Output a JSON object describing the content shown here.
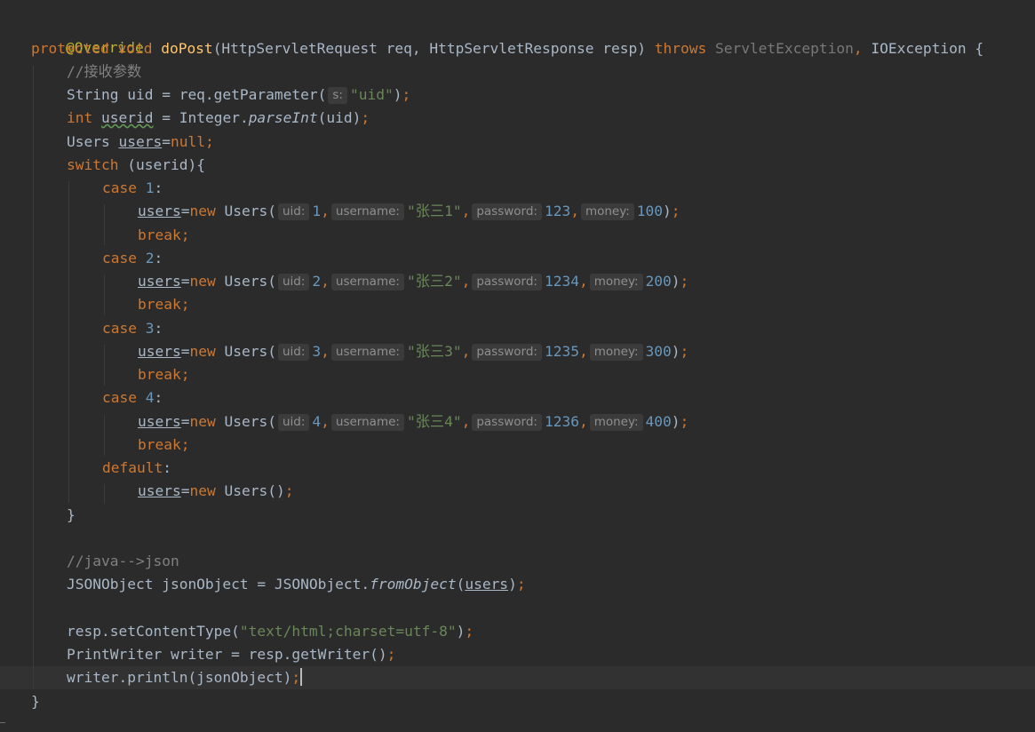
{
  "code": {
    "annotation": "@Override",
    "signature": {
      "modifier": "protected",
      "return_type": "void",
      "method_name": "doPost",
      "params": "(HttpServletRequest req, HttpServletResponse resp) ",
      "throws_kw": "throws",
      "exception1": "ServletException",
      "sep": ", ",
      "exception2": "IOException {"
    },
    "comment_params": "//接收参数",
    "line_uid": {
      "before": "String uid = req.getParameter(",
      "hint": "s:",
      "string": "\"uid\"",
      "close": ")",
      "semi": ";"
    },
    "line_userid": {
      "type": "int",
      "var": "userid",
      "rest": " = Integer.",
      "method": "parseInt",
      "args": "(uid)",
      "semi": ";"
    },
    "line_users_null": {
      "type": "Users ",
      "var": "users",
      "eq": "=",
      "null": "null",
      "semi": ";"
    },
    "line_switch": {
      "kw": "switch",
      "rest": " (userid){"
    },
    "cases": [
      {
        "case_kw": "case",
        "num": "1",
        "colon": ":",
        "var": "users",
        "eq": "=",
        "new": "new",
        "ctor": " Users(",
        "hint_uid": "uid:",
        "uid": "1",
        "hint_username": "username:",
        "username": "\"张三1\"",
        "hint_password": "password:",
        "password": "123",
        "hint_money": "money:",
        "money": "100",
        "close": ")",
        "semi": ";",
        "break": "break;"
      },
      {
        "case_kw": "case",
        "num": "2",
        "colon": ":",
        "var": "users",
        "eq": "=",
        "new": "new",
        "ctor": " Users(",
        "hint_uid": "uid:",
        "uid": "2",
        "hint_username": "username:",
        "username": "\"张三2\"",
        "hint_password": "password:",
        "password": "1234",
        "hint_money": "money:",
        "money": "200",
        "close": ")",
        "semi": ";",
        "break": "break;"
      },
      {
        "case_kw": "case",
        "num": "3",
        "colon": ":",
        "var": "users",
        "eq": "=",
        "new": "new",
        "ctor": " Users(",
        "hint_uid": "uid:",
        "uid": "3",
        "hint_username": "username:",
        "username": "\"张三3\"",
        "hint_password": "password:",
        "password": "1235",
        "hint_money": "money:",
        "money": "300",
        "close": ")",
        "semi": ";",
        "break": "break;"
      },
      {
        "case_kw": "case",
        "num": "4",
        "colon": ":",
        "var": "users",
        "eq": "=",
        "new": "new",
        "ctor": " Users(",
        "hint_uid": "uid:",
        "uid": "4",
        "hint_username": "username:",
        "username": "\"张三4\"",
        "hint_password": "password:",
        "password": "1236",
        "hint_money": "money:",
        "money": "400",
        "close": ")",
        "semi": ";",
        "break": "break;"
      }
    ],
    "default_case": {
      "kw": "default",
      "colon": ":",
      "var": "users",
      "eq": "=",
      "new": "new",
      "ctor": " Users()",
      "semi": ";"
    },
    "close_switch": "}",
    "comment_json": "//java-->json",
    "line_json": {
      "before": "JSONObject jsonObject = JSONObject.",
      "method": "fromObject",
      "open": "(",
      "var": "users",
      "close": ")",
      "semi": ";"
    },
    "line_content_type": {
      "before": "resp.setContentType(",
      "string": "\"text/html;charset=utf-8\"",
      "close": ")",
      "semi": ";"
    },
    "line_writer": {
      "before": "PrintWriter writer = resp.getWriter()",
      "semi": ";"
    },
    "line_println": {
      "before": "writer.println(jsonObject)",
      "semi": ";"
    },
    "close_method": "}"
  }
}
